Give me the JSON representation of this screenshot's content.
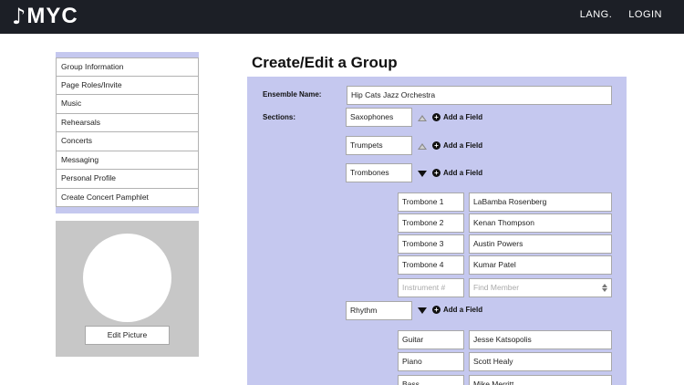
{
  "header": {
    "logo_note": "♪",
    "logo_text": "MYC",
    "nav": {
      "lang": "LANG.",
      "login": "LOGIN"
    }
  },
  "sidebar": {
    "items": [
      {
        "label": "Group Information"
      },
      {
        "label": "Page Roles/Invite"
      },
      {
        "label": "Music"
      },
      {
        "label": "Rehearsals"
      },
      {
        "label": "Concerts"
      },
      {
        "label": "Messaging"
      },
      {
        "label": "Personal Profile"
      },
      {
        "label": "Create Concert Pamphlet"
      }
    ],
    "edit_picture": "Edit Picture"
  },
  "main": {
    "title": "Create/Edit a Group",
    "ensemble_label": "Ensemble Name:",
    "ensemble_value": "Hip Cats Jazz Orchestra",
    "sections_label": "Sections:",
    "add_field_label": "Add a Field",
    "sections": [
      {
        "name": "Saxophones",
        "expanded": false
      },
      {
        "name": "Trumpets",
        "expanded": false
      },
      {
        "name": "Trombones",
        "expanded": true,
        "members": [
          {
            "instrument": "Trombone 1",
            "member": "LaBamba Rosenberg"
          },
          {
            "instrument": "Trombone 2",
            "member": "Kenan Thompson"
          },
          {
            "instrument": "Trombone 3",
            "member": "Austin Powers"
          },
          {
            "instrument": "Trombone 4",
            "member": "Kumar Patel"
          }
        ],
        "new_row": {
          "instrument_placeholder": "Instrument #",
          "member_placeholder": "Find Member"
        }
      },
      {
        "name": "Rhythm",
        "expanded": true,
        "members": [
          {
            "instrument": "Guitar",
            "member": "Jesse Katsopolis"
          },
          {
            "instrument": "Piano",
            "member": "Scott Healy"
          },
          {
            "instrument": "Bass",
            "member": "Mike Merritt"
          }
        ]
      }
    ]
  },
  "colors": {
    "topbar": "#1c1f26",
    "panel": "#c5c8ef",
    "profile_bg": "#c7c7c7"
  }
}
